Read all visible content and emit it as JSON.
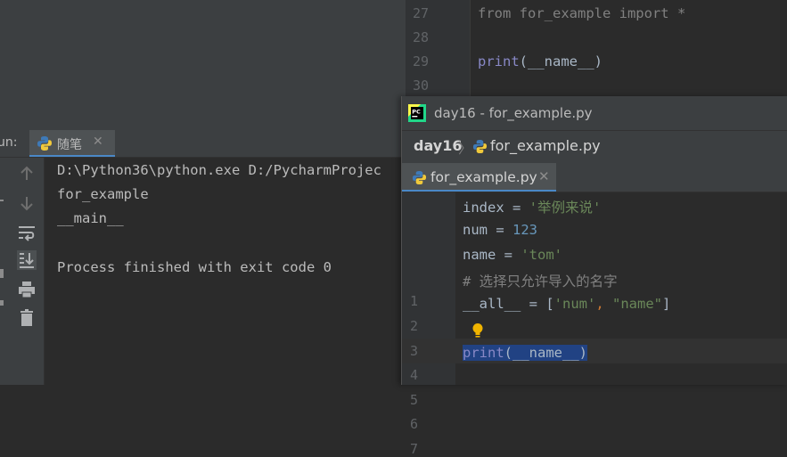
{
  "top_editor": {
    "lines": [
      {
        "num": "27",
        "code": "from for_example import *"
      },
      {
        "num": "28",
        "code": ""
      },
      {
        "num": "29",
        "code_fn": "print",
        "code_rest": "(__name__)"
      },
      {
        "num": "30",
        "code": ""
      }
    ]
  },
  "run_window": {
    "label": "un:",
    "tab_label": "随笔",
    "console_lines": [
      "D:\\Python36\\python.exe D:/PycharmProjec",
      "for_example",
      "__main__",
      "",
      "Process finished with exit code 0"
    ],
    "toolbar_icons": [
      "arrow-up-icon",
      "arrow-down-icon",
      "soft-wrap-icon",
      "scroll-to-end-icon",
      "print-icon",
      "trash-icon"
    ]
  },
  "popup": {
    "title": "day16 - for_example.py",
    "breadcrumb": {
      "project": "day16",
      "file": "for_example.py"
    },
    "tab_label": "for_example.py",
    "lines": [
      {
        "num": "1",
        "name": "index",
        "eq": " = ",
        "str": "'举例来说'"
      },
      {
        "num": "2",
        "name": "num",
        "eq": " = ",
        "num_val": "123"
      },
      {
        "num": "3",
        "name": "name",
        "eq": " = ",
        "str": "'tom'"
      },
      {
        "num": "4",
        "comment": "# 选择只允许导入的名字"
      },
      {
        "num": "5",
        "name": "__all__",
        "eq": " = [",
        "s1": "'num'",
        "comma": ", ",
        "s2": "\"name\"",
        "close": "]"
      },
      {
        "num": "6"
      },
      {
        "num": "7",
        "fn": "print",
        "rest": "(__name__)"
      }
    ]
  },
  "colors": {
    "string": "#6a8759",
    "number": "#6897bb",
    "comment": "#808080",
    "keyword": "#cc7832",
    "selection": "#214283",
    "accent": "#4a88c7"
  }
}
